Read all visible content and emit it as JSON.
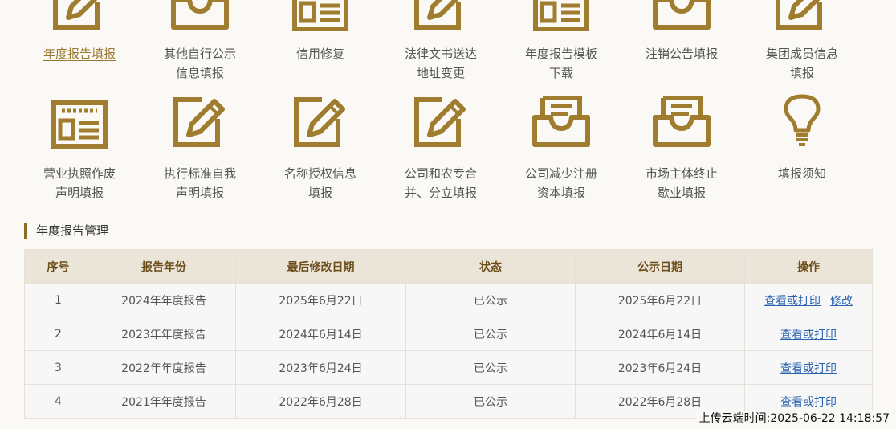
{
  "tiles": [
    {
      "label": "年度报告填报",
      "icon": "edit-icon",
      "active": true
    },
    {
      "label": "其他自行公示\n信息填报",
      "icon": "inbox-icon"
    },
    {
      "label": "信用修复",
      "icon": "form-icon"
    },
    {
      "label": "法律文书送达\n地址变更",
      "icon": "edit-icon"
    },
    {
      "label": "年度报告模板\n下载",
      "icon": "form-icon"
    },
    {
      "label": "注销公告填报",
      "icon": "inbox-icon"
    },
    {
      "label": "集团成员信息\n填报",
      "icon": "edit-icon"
    },
    {
      "label": "营业执照作废\n声明填报",
      "icon": "form-icon"
    },
    {
      "label": "执行标准自我\n声明填报",
      "icon": "edit-icon"
    },
    {
      "label": "名称授权信息\n填报",
      "icon": "edit-icon"
    },
    {
      "label": "公司和农专合\n并、分立填报",
      "icon": "edit-icon"
    },
    {
      "label": "公司减少注册\n资本填报",
      "icon": "inbox-icon"
    },
    {
      "label": "市场主体终止\n歇业填报",
      "icon": "inbox-icon"
    },
    {
      "label": "填报须知",
      "icon": "lightbulb-icon"
    }
  ],
  "section_title": "年度报告管理",
  "table": {
    "headers": [
      "序号",
      "报告年份",
      "最后修改日期",
      "状态",
      "公示日期",
      "操作"
    ],
    "rows": [
      {
        "no": "1",
        "year": "2024年年度报告",
        "modified": "2025年6月22日",
        "status": "已公示",
        "published": "2025年6月22日",
        "actions": [
          "查看或打印",
          "修改"
        ]
      },
      {
        "no": "2",
        "year": "2023年年度报告",
        "modified": "2024年6月14日",
        "status": "已公示",
        "published": "2024年6月14日",
        "actions": [
          "查看或打印"
        ]
      },
      {
        "no": "3",
        "year": "2022年年度报告",
        "modified": "2023年6月24日",
        "status": "已公示",
        "published": "2023年6月24日",
        "actions": [
          "查看或打印"
        ]
      },
      {
        "no": "4",
        "year": "2021年年度报告",
        "modified": "2022年6月28日",
        "status": "已公示",
        "published": "2022年6月28日",
        "actions": [
          "查看或打印"
        ]
      }
    ]
  },
  "upload_time": "上传云端时间:2025-06-22 14:18:57",
  "colors": {
    "gold": "#a07c2e",
    "header_bg": "#ebe4d8",
    "link": "#2a64b0"
  }
}
